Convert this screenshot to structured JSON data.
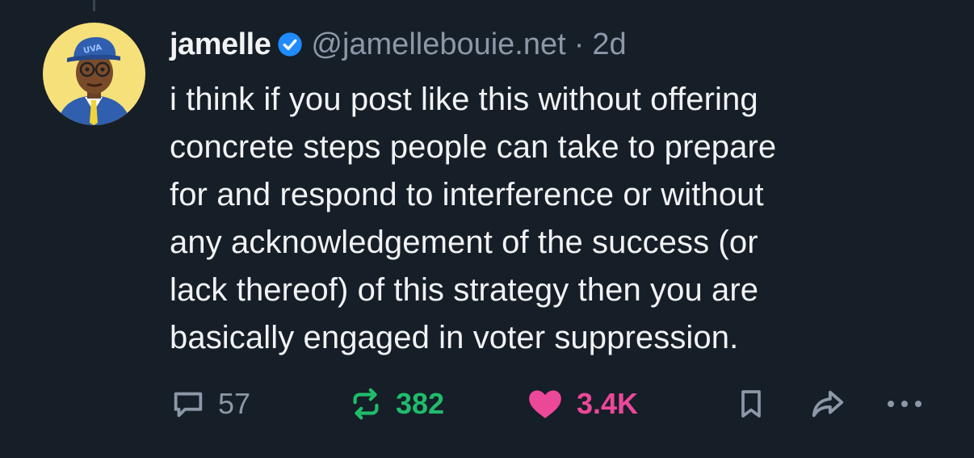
{
  "post": {
    "display_name": "jamelle",
    "handle": "@jamellebouie.net",
    "separator": "·",
    "age": "2d",
    "text": "i think if you post like this without offering\nconcrete steps people can take to prepare\nfor and respond to interference or without\nany acknowledgement of the success (or\nlack thereof) of this strategy then you are\nbasically engaged in voter suppression.",
    "avatar_cap_text": "UVA"
  },
  "actions": {
    "replies": "57",
    "reposts": "382",
    "likes": "3.4K"
  },
  "colors": {
    "background": "#161e27",
    "verified": "#208bfe",
    "repost_active": "#20bc6c",
    "like_active": "#ec4899",
    "muted": "#8c98a8"
  },
  "icons": [
    "reply-icon",
    "repost-icon",
    "heart-icon",
    "bookmark-icon",
    "share-icon",
    "more-icon",
    "verified-badge-icon"
  ]
}
